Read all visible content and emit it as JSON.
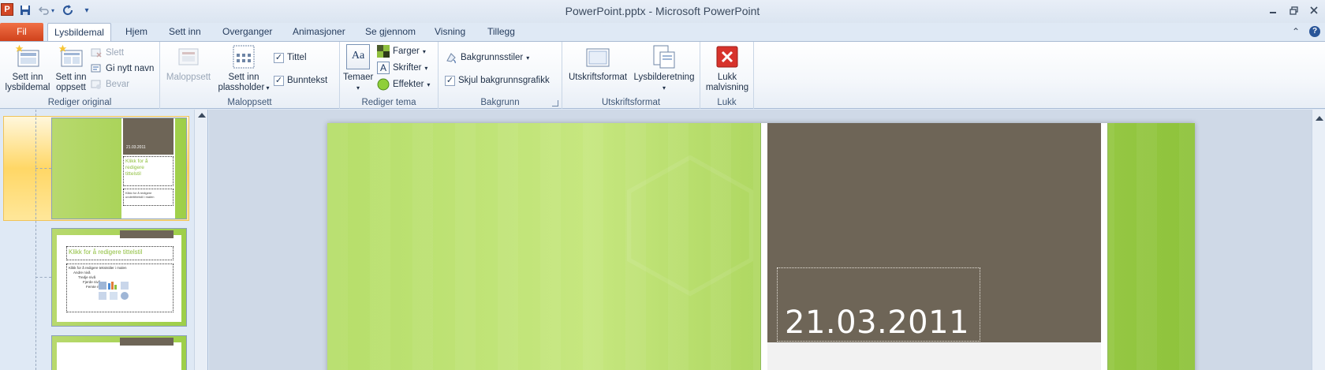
{
  "window": {
    "title": "PowerPoint.pptx  -  Microsoft PowerPoint",
    "app_icon_letter": "P"
  },
  "quick_access": [
    {
      "name": "save-icon"
    },
    {
      "name": "undo-icon"
    },
    {
      "name": "redo-icon"
    },
    {
      "name": "customize-qat-icon"
    }
  ],
  "tabs": {
    "file": "Fil",
    "items": [
      "Lysbildemal",
      "Hjem",
      "Sett inn",
      "Overganger",
      "Animasjoner",
      "Se gjennom",
      "Visning",
      "Tillegg"
    ],
    "active": "Lysbildemal"
  },
  "ribbon": {
    "rediger_original": {
      "label": "Rediger original",
      "insert_master": "Sett inn\nlysbildemal",
      "insert_layout": "Sett inn\noppsett",
      "delete": "Slett",
      "rename": "Gi nytt navn",
      "preserve": "Bevar"
    },
    "maloppsett": {
      "label": "Maloppsett",
      "master_layout": "Maloppsett",
      "insert_placeholder": "Sett inn\nplassholder",
      "title_check": "Tittel",
      "footer_check": "Bunntekst"
    },
    "rediger_tema": {
      "label": "Rediger tema",
      "themes": "Temaer",
      "colors": "Farger",
      "fonts": "Skrifter",
      "effects": "Effekter"
    },
    "bakgrunn": {
      "label": "Bakgrunn",
      "background_styles": "Bakgrunnsstiler",
      "hide_background": "Skjul bakgrunnsgrafikk"
    },
    "utskriftsformat": {
      "label": "Utskriftsformat",
      "page_setup": "Utskriftsformat",
      "orientation": "Lysbilderetning"
    },
    "lukk": {
      "label": "Lukk",
      "close_master": "Lukk\nmalvisning"
    }
  },
  "thumbnails": {
    "t1_title": "Klikk for å\nredigere\ntittelstil",
    "t1_date": "21.03.2011",
    "t1_text": "Klikk for å redigere\nundertittelstil i malen",
    "t2_title": "Klikk for å redigere tittelstil",
    "t2_bullets": [
      "Klikk for å redigere tekststiler i malen",
      "Andre nivå",
      "Tredje nivå",
      "Fjerde nivå",
      "Femte nivå"
    ]
  },
  "slide": {
    "date": "21.03.2011"
  },
  "colors": {
    "accent_file_tab": "#d24726",
    "slide_green": "#b6de6a",
    "brown_box": "#6e6557"
  }
}
